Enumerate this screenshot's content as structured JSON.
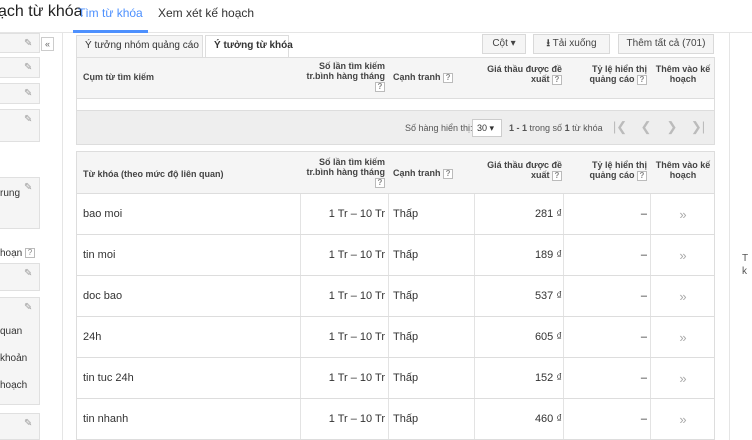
{
  "topnav": {
    "app_title": "ạch từ khóa",
    "tab_search": "Tìm từ khóa",
    "tab_plan": "Xem xét kế hoạch"
  },
  "sidebar": {
    "collapse_glyph": "«",
    "text_rung": "rung",
    "text_hoan": "hoạn",
    "text_quan": "quan",
    "text_khoan": "khoản",
    "text_hoach": "hoạch",
    "help": "?"
  },
  "subtabs": {
    "ad_group_ideas": "Ý tưởng nhóm quảng cáo",
    "keyword_ideas": "Ý tưởng từ khóa"
  },
  "toolbar": {
    "columns": "Cột",
    "columns_caret": "▾",
    "download": "Tải xuống",
    "download_icon": "⭳",
    "add_all": "Thêm tất cả (701)"
  },
  "search_terms_table": {
    "col_term": "Cụm từ tìm kiếm",
    "col_volume": "Số lần tìm kiếm tr.bình hàng tháng",
    "col_competition": "Cạnh tranh",
    "col_bid": "Giá thầu được đề xuất",
    "col_share": "Tỷ lệ hiển thị quảng cáo",
    "col_add": "Thêm vào kế hoạch"
  },
  "pager": {
    "rows_label": "Số hàng hiển thị:",
    "rows_value": "30",
    "rows_caret": "▾",
    "range_prefix": "1 - 1",
    "range_suffix": "trong số",
    "range_total": "1",
    "range_unit": "từ khóa",
    "first": "|❮",
    "prev": "❮",
    "next": "❯",
    "last": "❯|"
  },
  "keyword_table": {
    "col_keyword": "Từ khóa (theo mức độ liên quan)",
    "col_volume": "Số lần tìm kiếm tr.bình hàng tháng",
    "col_competition": "Cạnh tranh",
    "col_bid": "Giá thầu được đề xuất",
    "col_share": "Tỷ lệ hiển thị quảng cáo",
    "col_add": "Thêm vào kế hoạch",
    "rows": [
      {
        "keyword": "bao moi",
        "volume": "1 Tr – 10 Tr",
        "competition": "Thấp",
        "bid": "281 ₫",
        "share": "–",
        "add": "»"
      },
      {
        "keyword": "tin moi",
        "volume": "1 Tr – 10 Tr",
        "competition": "Thấp",
        "bid": "189 ₫",
        "share": "–",
        "add": "»"
      },
      {
        "keyword": "doc bao",
        "volume": "1 Tr – 10 Tr",
        "competition": "Thấp",
        "bid": "537 ₫",
        "share": "–",
        "add": "»"
      },
      {
        "keyword": "24h",
        "volume": "1 Tr – 10 Tr",
        "competition": "Thấp",
        "bid": "605 ₫",
        "share": "–",
        "add": "»"
      },
      {
        "keyword": "tin tuc 24h",
        "volume": "1 Tr – 10 Tr",
        "competition": "Thấp",
        "bid": "152 ₫",
        "share": "–",
        "add": "»"
      },
      {
        "keyword": "tin nhanh",
        "volume": "1 Tr – 10 Tr",
        "competition": "Thấp",
        "bid": "460 ₫",
        "share": "–",
        "add": "»"
      }
    ]
  },
  "right_edge": {
    "line1": "T",
    "line2": "k"
  },
  "colors": {
    "accent": "#4d90fe",
    "header_bg": "#f5f5f5",
    "border": "#dddddd"
  }
}
